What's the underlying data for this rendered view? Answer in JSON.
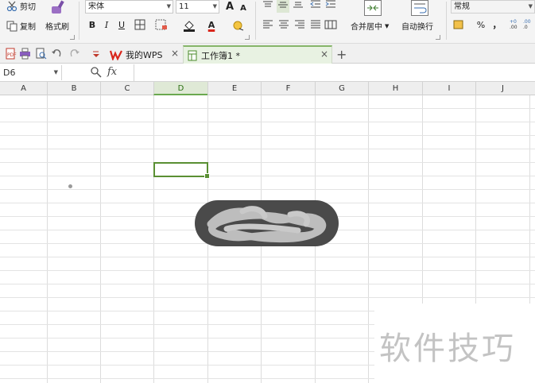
{
  "ribbon": {
    "clipboard": {
      "cut_label": "剪切",
      "copy_label": "复制",
      "format_painter_label": "格式刷"
    },
    "font": {
      "name": "宋体",
      "size": "11",
      "bold": "B",
      "italic": "I",
      "underline": "U",
      "grow": "A",
      "shrink": "A"
    },
    "alignment": {
      "merge_center_label": "合并居中",
      "auto_wrap_label": "自动换行"
    },
    "number": {
      "format": "常规",
      "percent": "%",
      "comma": "，"
    }
  },
  "tabs": {
    "wps_tab_label": "我的WPS",
    "workbook_tab_label": "工作簿1 *",
    "new_tab_symbol": "+",
    "close_symbol": "×"
  },
  "formula_bar": {
    "name_box": "D6",
    "zoom_icon": "magnifier",
    "fx_label": "fx",
    "formula_value": ""
  },
  "columns": [
    "A",
    "B",
    "C",
    "D",
    "E",
    "F",
    "G",
    "H",
    "I",
    "J"
  ],
  "selected_cell": {
    "column": "D",
    "row": 6
  },
  "watermark": {
    "text": "软件技巧"
  },
  "colors": {
    "accent_green": "#5a8f33",
    "wps_red": "#d9261c",
    "toast_bg": "#4a4a4a"
  }
}
